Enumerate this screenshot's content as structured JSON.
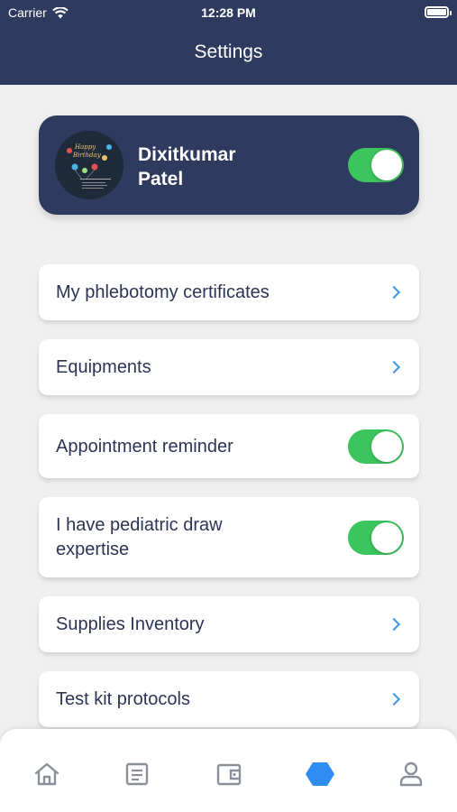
{
  "status_bar": {
    "carrier": "Carrier",
    "time": "12:28 PM"
  },
  "header": {
    "title": "Settings"
  },
  "profile": {
    "name_line1": "Dixitkumar",
    "name_line2": "Patel",
    "available": true,
    "avatar": "birthday-card-image"
  },
  "settings": [
    {
      "label": "My phlebotomy certificates",
      "control": "chevron"
    },
    {
      "label": "Equipments",
      "control": "chevron"
    },
    {
      "label": "Appointment reminder",
      "control": "toggle",
      "on": true
    },
    {
      "label_line1": "I have pediatric draw",
      "label_line2": "expertise",
      "control": "toggle",
      "on": true
    },
    {
      "label": "Supplies Inventory",
      "control": "chevron"
    },
    {
      "label": "Test kit protocols",
      "control": "chevron"
    }
  ],
  "tabbar": {
    "items": [
      "home-icon",
      "document-icon",
      "wallet-icon",
      "hexagon-icon",
      "profile-icon"
    ],
    "active": "hexagon-icon",
    "active_color": "#2f8cf0",
    "inactive_color": "#8a8f99"
  },
  "colors": {
    "brand": "#2f3a5f",
    "toggle_on": "#3cc45d",
    "chevron": "#3b94e4"
  }
}
